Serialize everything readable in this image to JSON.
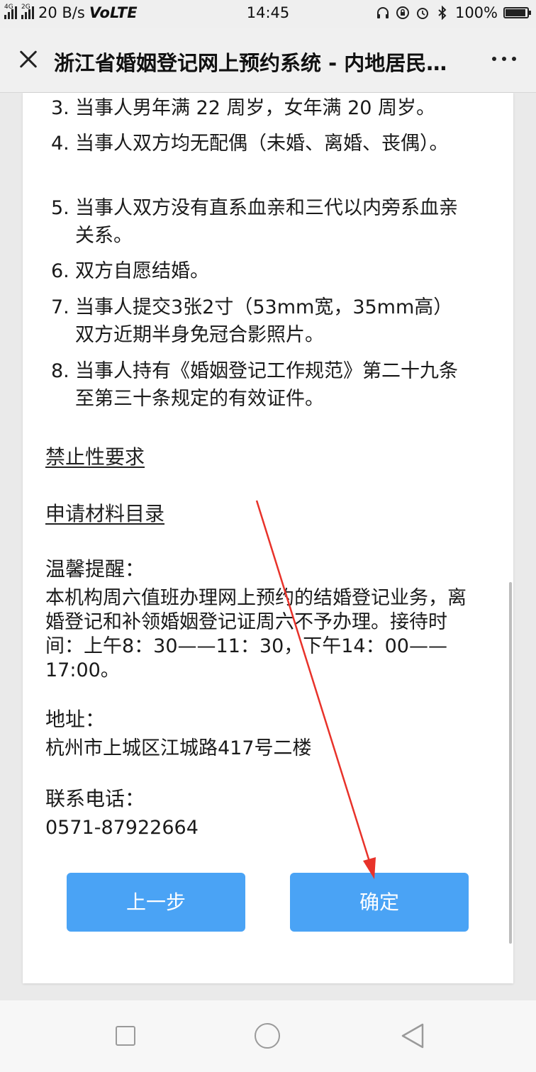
{
  "status_bar": {
    "network_1": "4G",
    "network_2": "2G",
    "speed": "20 B/s",
    "volte": "VoLTE",
    "time": "14:45",
    "battery": "100%",
    "battery_level": 1.0
  },
  "header": {
    "title": "浙江省婚姻登记网上预约系统 - 内地居民…"
  },
  "requirements": [
    {
      "num": "3.",
      "text": "当事人男年满 22 周岁，女年满 20 周岁。"
    },
    {
      "num": "4.",
      "text": "当事人双方均无配偶（未婚、离婚、丧偶）。"
    },
    {
      "num": "5.",
      "text": "当事人双方没有直系血亲和三代以内旁系血亲关系。"
    },
    {
      "num": "6.",
      "text": "双方自愿结婚。"
    },
    {
      "num": "7.",
      "text": "当事人提交3张2寸（53mm宽，35mm高）双方近期半身免冠合影照片。"
    },
    {
      "num": "8.",
      "text": "当事人持有《婚姻登记工作规范》第二十九条至第三十条规定的有效证件。"
    }
  ],
  "links": {
    "prohibitions": "禁止性要求",
    "materials": "申请材料目录"
  },
  "reminder": {
    "label": "温馨提醒：",
    "text": "本机构周六值班办理网上预约的结婚登记业务，离婚登记和补领婚姻登记证周六不予办理。接待时间：上午8：30——11：30，下午14：00——17:00。"
  },
  "address": {
    "label": "地址：",
    "value": "杭州市上城区江城路417号二楼"
  },
  "phone": {
    "label": "联系电话：",
    "value": "0571-87922664"
  },
  "buttons": {
    "prev": "上一步",
    "confirm": "确定"
  },
  "colors": {
    "button": "#4aa3f5",
    "arrow": "#e8322a"
  }
}
